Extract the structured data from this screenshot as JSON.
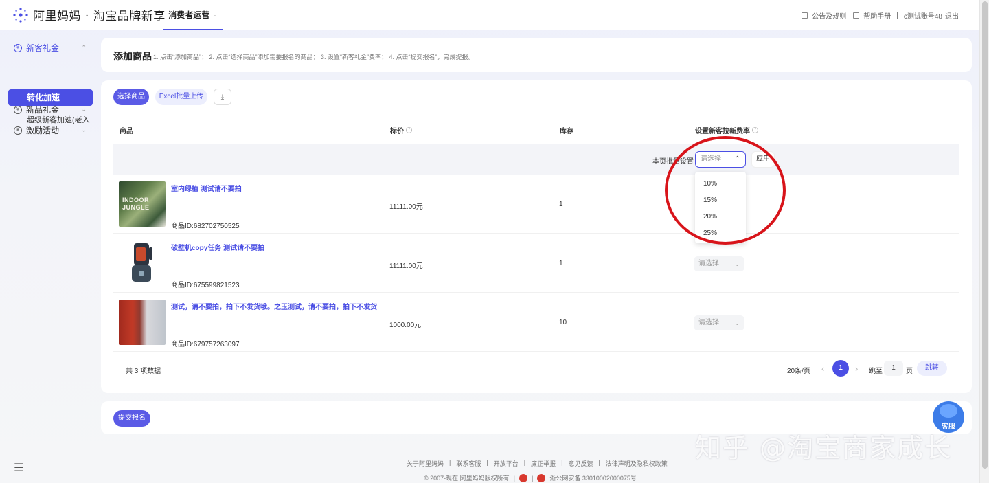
{
  "header": {
    "logo_text": "阿里妈妈 · 淘宝品牌新享",
    "nav_tab": "消费者运营",
    "links": [
      "公告及规则",
      "帮助手册",
      "|",
      "c测试账号48",
      "退出"
    ]
  },
  "sidebar": {
    "items": [
      {
        "label": "新客礼金"
      },
      {
        "label": "转化加速"
      },
      {
        "label": "超级新客加速(老入"
      },
      {
        "label": "新品礼金"
      },
      {
        "label": "激励活动"
      }
    ]
  },
  "intro": {
    "title": "添加商品",
    "hint": "1. 点击“添加商品”； 2. 点击“选择商品”添加需要报名的商品； 3. 设置“新客礼金”费率； 4. 点击“提交报名”，完成提报。"
  },
  "toolbar": {
    "select_goods": "选择商品",
    "excel_upload": "Excel批量上传",
    "download_icon": "⤓"
  },
  "table": {
    "headers": [
      "商品",
      "标价",
      "库存",
      "设置新客拉新费率"
    ],
    "batch_label": "本页批量设置",
    "batch_placeholder": "请选择",
    "apply_label": "应用",
    "rows": [
      {
        "name": "室内绿植 测试请不要拍",
        "id": "商品ID:682702750525",
        "price": "11111.00元",
        "stock": "1",
        "select": "请选择"
      },
      {
        "name": "破壁机copy任务 测试请不要拍",
        "id": "商品ID:675599821523",
        "price": "11111.00元",
        "stock": "1",
        "select": "请选择"
      },
      {
        "name": "测试，请不要拍，拍下不发货哦。之玉测试，请不要拍，拍下不发货",
        "id": "商品ID:679757263097",
        "price": "1000.00元",
        "stock": "10",
        "select": "请选择"
      }
    ],
    "thumb_text": "INDOOR JUNGLE"
  },
  "dropdown": {
    "options": [
      "10%",
      "15%",
      "20%",
      "25%"
    ]
  },
  "pagination": {
    "total": "共 3 项数据",
    "page_size": "20条/页",
    "prev": "‹",
    "current": "1",
    "next": "›",
    "jump_to": "跳至",
    "jump_value": "1",
    "page_unit": "页",
    "jump_button": "跳转"
  },
  "submit": {
    "label": "提交报名"
  },
  "service": {
    "label": "客服"
  },
  "footer": {
    "links": [
      "关于阿里妈妈",
      "|",
      "联系客服",
      "|",
      "开放平台",
      "|",
      "廉正举报",
      "|",
      "意见反馈",
      "|",
      "法律声明及隐私权政策"
    ],
    "copyright": "© 2007-现在 阿里妈妈版权所有",
    "icp": "浙公网安备 33010002000075号"
  },
  "watermark": "知乎 @淘宝商家成长",
  "colors": {
    "accent": "#4b4fe4",
    "highlight_circle": "#d8141a"
  }
}
